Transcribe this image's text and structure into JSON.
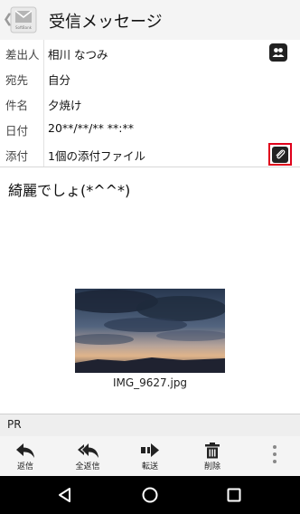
{
  "header": {
    "title": "受信メッセージ",
    "app_icon_caption": "SoftBank"
  },
  "meta": {
    "sender": {
      "label": "差出人",
      "value": "相川 なつみ"
    },
    "to": {
      "label": "宛先",
      "value": "自分"
    },
    "subject": {
      "label": "件名",
      "value": "夕焼け"
    },
    "date": {
      "label": "日付",
      "value": "20**/**/** **:**"
    },
    "attachment": {
      "label": "添付",
      "value": "1個の添付ファイル"
    }
  },
  "message": {
    "body": "綺麗でしょ(*^^*)",
    "attachment_filename": "IMG_9627.jpg"
  },
  "pr_bar": {
    "label": "PR"
  },
  "toolbar": {
    "reply": "返信",
    "reply_all": "全返信",
    "forward": "転送",
    "delete": "削除"
  },
  "icons": {
    "back": "chevron-left-icon",
    "app": "mail-app-icon",
    "contact": "contact-book-icon",
    "attachment": "paperclip-icon",
    "more": "more-vertical-icon",
    "nav": [
      "back-triangle-icon",
      "home-circle-icon",
      "recents-square-icon"
    ]
  },
  "colors": {
    "highlight": "#e0001b",
    "header_bg": "#f4f4f4",
    "navbar_bg": "#000000"
  }
}
